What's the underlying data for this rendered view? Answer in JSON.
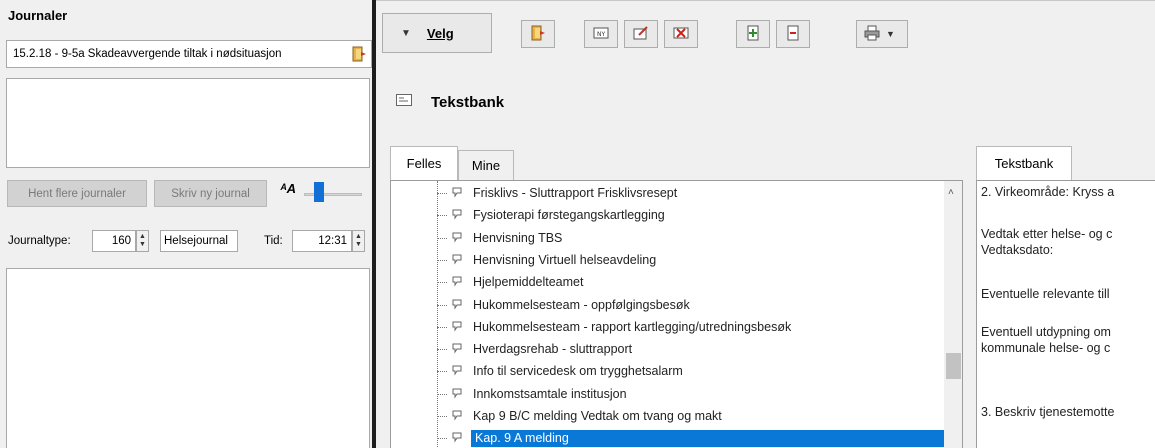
{
  "left": {
    "title": "Journaler",
    "journal_selected": "15.2.18 - 9-5a Skadeavvergende tiltak i nødsituasjon",
    "fetch_more_button": "Hent flere journaler",
    "write_new_button": "Skriv ny journal",
    "font_icon_label": "ᴬA",
    "journaltype_label": "Journaltype:",
    "journaltype_code": "160",
    "journaltype_name": "Helsejournal",
    "time_label": "Tid:",
    "time_value": "12:31"
  },
  "toolbar": {
    "velg_label": "Velg"
  },
  "tekstbank": {
    "heading": "Tekstbank",
    "tabs": [
      "Felles",
      "Mine"
    ],
    "active_tab": "Felles",
    "right_tab": "Tekstbank",
    "tree_items": [
      "Frisklivs - Sluttrapport Frisklivsresept",
      "Fysioterapi førstegangskartlegging",
      "Henvisning TBS",
      "Henvisning Virtuell helseavdeling",
      "Hjelpemiddelteamet",
      "Hukommelsesteam - oppfølgingsbesøk",
      "Hukommelsesteam - rapport kartlegging/utredningsbesøk",
      "Hverdagsrehab - sluttrapport",
      "Info til servicedesk om trygghetsalarm",
      "Innkomstsamtale institusjon",
      "Kap 9 B/C melding Vedtak om tvang og makt",
      "Kap. 9 A melding"
    ],
    "selected_item": "Kap. 9 A melding",
    "preview_lines": [
      "2. Virkeområde: Kryss a",
      "Vedtak etter helse- og c",
      "Vedtaksdato:",
      "Eventuelle relevante till",
      "Eventuell utdypning om",
      "kommunale helse- og c",
      "3. Beskriv tjenestemotte"
    ]
  },
  "colors": {
    "selection": "#0a78d7",
    "panel": "#f0f0f0",
    "divider": "#1d1d1d"
  }
}
